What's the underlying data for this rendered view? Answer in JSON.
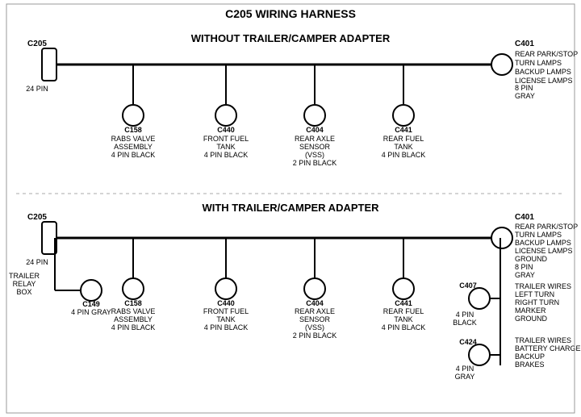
{
  "title": "C205 WIRING HARNESS",
  "top_section": {
    "label": "WITHOUT TRAILER/CAMPER ADAPTER",
    "left_connector": {
      "name": "C205",
      "pins": "24 PIN"
    },
    "right_connector": {
      "name": "C401",
      "pins": "8 PIN",
      "color": "GRAY",
      "desc": "REAR PARK/STOP\nTURN LAMPS\nBACKUP LAMPS\nLICENSE LAMPS"
    },
    "connectors": [
      {
        "name": "C158",
        "desc": "RABS VALVE\nASSEMBLY\n4 PIN BLACK"
      },
      {
        "name": "C440",
        "desc": "FRONT FUEL\nTANK\n4 PIN BLACK"
      },
      {
        "name": "C404",
        "desc": "REAR AXLE\nSENSOR\n(VSS)\n2 PIN BLACK"
      },
      {
        "name": "C441",
        "desc": "REAR FUEL\nTANK\n4 PIN BLACK"
      }
    ]
  },
  "bottom_section": {
    "label": "WITH TRAILER/CAMPER ADAPTER",
    "left_connector": {
      "name": "C205",
      "pins": "24 PIN"
    },
    "extra_connector": {
      "name": "C149",
      "pins": "4 PIN GRAY",
      "label": "TRAILER\nRELAY\nBOX"
    },
    "right_connector": {
      "name": "C401",
      "pins": "8 PIN",
      "color": "GRAY",
      "desc": "REAR PARK/STOP\nTURN LAMPS\nBACKUP LAMPS\nLICENSE LAMPS\nGROUND"
    },
    "right_connector2": {
      "name": "C407",
      "pins": "4 PIN\nBLACK",
      "desc": "TRAILER WIRES\nLEFT TURN\nRIGHT TURN\nMARKER\nGROUND"
    },
    "right_connector3": {
      "name": "C424",
      "pins": "4 PIN\nGRAY",
      "desc": "TRAILER WIRES\nBATTERY CHARGE\nBACKUP\nBRAKES"
    },
    "connectors": [
      {
        "name": "C158",
        "desc": "RABS VALVE\nASSEMBLY\n4 PIN BLACK"
      },
      {
        "name": "C440",
        "desc": "FRONT FUEL\nTANK\n4 PIN BLACK"
      },
      {
        "name": "C404",
        "desc": "REAR AXLE\nSENSOR\n(VSS)\n2 PIN BLACK"
      },
      {
        "name": "C441",
        "desc": "REAR FUEL\nTANK\n4 PIN BLACK"
      }
    ]
  }
}
